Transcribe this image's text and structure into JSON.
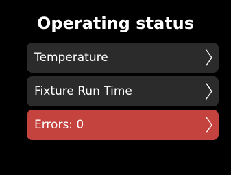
{
  "screen": {
    "title": "Operating status"
  },
  "menu": {
    "items": [
      {
        "label": "Temperature",
        "selected": false,
        "icon": "chevron-right-icon"
      },
      {
        "label": "Fixture Run Time",
        "selected": false,
        "icon": "chevron-right-icon"
      },
      {
        "label": "Errors: 0",
        "selected": true,
        "icon": "chevron-right-icon"
      }
    ]
  },
  "colors": {
    "background": "#000000",
    "item_background": "#2b2b2b",
    "selected_background": "#c4433e",
    "text": "#ffffff"
  }
}
